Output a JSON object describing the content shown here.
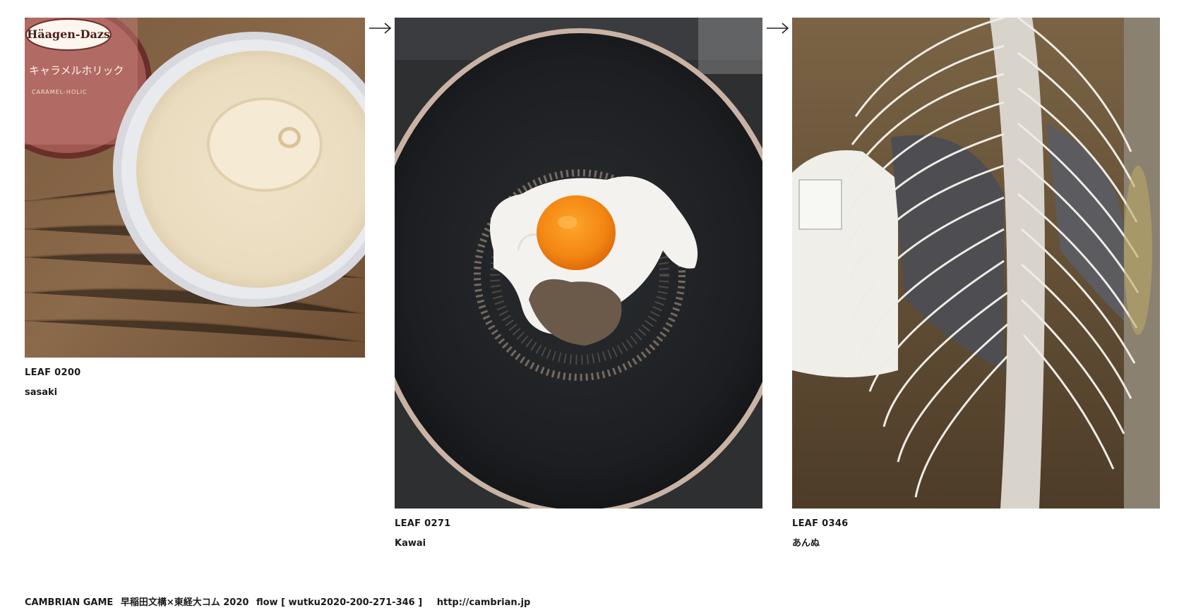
{
  "leaves": [
    {
      "id_label": "LEAF 0200",
      "author": "sasaki",
      "image_icon": "ice-cream-cup-photo",
      "image_text": {
        "brand": "Häagen-Dazs",
        "flavor_jp": "キャラメルホリック",
        "flavor_en": "CARAMEL-HOLIC"
      }
    },
    {
      "id_label": "LEAF 0271",
      "author": "Kawai",
      "image_icon": "fried-egg-pan-photo"
    },
    {
      "id_label": "LEAF 0346",
      "author": "あんぬ",
      "image_icon": "electric-fan-photo"
    }
  ],
  "arrow_icon": "right-arrow-icon",
  "footer": {
    "title": "CAMBRIAN GAME",
    "project": "早稲田文構×東経大コム 2020",
    "flow": "flow [ wutku2020-200-271-346 ]",
    "url": "http://cambrian.jp"
  }
}
